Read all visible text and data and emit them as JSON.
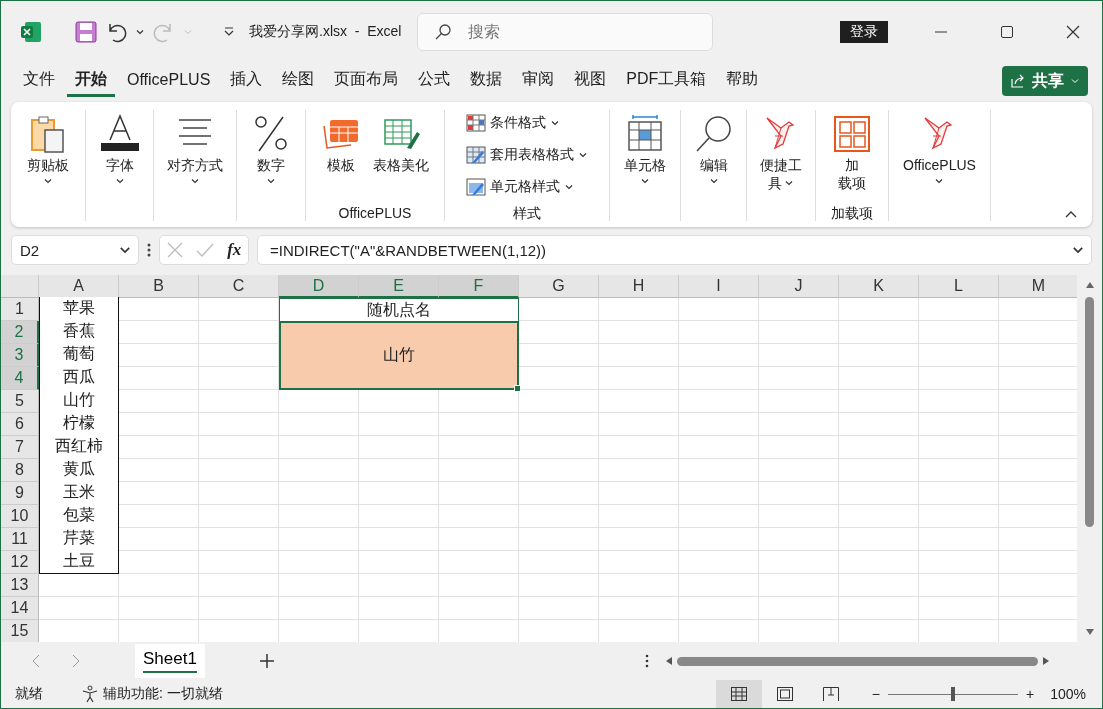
{
  "title_bar": {
    "title": "我爱分享网.xlsx  -  Excel",
    "search_placeholder": "搜索",
    "login": "登录",
    "redo_disabled": true
  },
  "menu_tabs": [
    {
      "label": "文件",
      "selected": false
    },
    {
      "label": "开始",
      "selected": true
    },
    {
      "label": "OfficePLUS",
      "selected": false
    },
    {
      "label": "插入",
      "selected": false
    },
    {
      "label": "绘图",
      "selected": false
    },
    {
      "label": "页面布局",
      "selected": false
    },
    {
      "label": "公式",
      "selected": false
    },
    {
      "label": "数据",
      "selected": false
    },
    {
      "label": "审阅",
      "selected": false
    },
    {
      "label": "视图",
      "selected": false
    },
    {
      "label": "PDF工具箱",
      "selected": false
    },
    {
      "label": "帮助",
      "selected": false
    }
  ],
  "share_button": "共享",
  "ribbon": {
    "groups": [
      {
        "buttons": [
          {
            "kind": "large",
            "lines": [
              "剪贴板"
            ],
            "dropdown": true
          }
        ]
      },
      {
        "buttons": [
          {
            "kind": "large",
            "lines": [
              "字体"
            ],
            "dropdown": true
          }
        ]
      },
      {
        "buttons": [
          {
            "kind": "large",
            "lines": [
              "对齐方式"
            ],
            "dropdown": true
          }
        ]
      },
      {
        "buttons": [
          {
            "kind": "large",
            "lines": [
              "数字"
            ],
            "dropdown": true
          }
        ]
      },
      {
        "label": "OfficePLUS",
        "buttons": [
          {
            "kind": "large",
            "lines": [
              "模板"
            ],
            "dropdown": false
          },
          {
            "kind": "large",
            "lines": [
              "表格美化"
            ],
            "dropdown": false
          }
        ]
      },
      {
        "label": "样式",
        "buttons": [
          {
            "kind": "small",
            "lines": [
              "条件格式"
            ],
            "dropdown": true
          },
          {
            "kind": "small",
            "lines": [
              "套用表格格式"
            ],
            "dropdown": true
          },
          {
            "kind": "small",
            "lines": [
              "单元格样式"
            ],
            "dropdown": true
          }
        ]
      },
      {
        "buttons": [
          {
            "kind": "large",
            "lines": [
              "单元格"
            ],
            "dropdown": true
          }
        ]
      },
      {
        "buttons": [
          {
            "kind": "large",
            "lines": [
              "编辑"
            ],
            "dropdown": true
          }
        ]
      },
      {
        "buttons": [
          {
            "kind": "large",
            "lines": [
              "便捷工",
              "具"
            ],
            "dropdown": true
          }
        ]
      },
      {
        "label": "加载项",
        "buttons": [
          {
            "kind": "large",
            "lines": [
              "加",
              "载项"
            ],
            "dropdown": false
          }
        ]
      },
      {
        "buttons": [
          {
            "kind": "large",
            "lines": [
              "OfficePLUS"
            ],
            "dropdown": true
          }
        ]
      }
    ]
  },
  "formula_bar": {
    "name_box": "D2",
    "function_label": "fx",
    "formula": "=INDIRECT(\"A\"&RANDBETWEEN(1,12))"
  },
  "sheet": {
    "columns": [
      {
        "label": "A",
        "selected": false
      },
      {
        "label": "B",
        "selected": false
      },
      {
        "label": "C",
        "selected": false
      },
      {
        "label": "D",
        "selected": true
      },
      {
        "label": "E",
        "selected": true
      },
      {
        "label": "F",
        "selected": true
      },
      {
        "label": "G",
        "selected": false
      },
      {
        "label": "H",
        "selected": false
      },
      {
        "label": "I",
        "selected": false
      },
      {
        "label": "J",
        "selected": false
      },
      {
        "label": "K",
        "selected": false
      },
      {
        "label": "L",
        "selected": false
      },
      {
        "label": "M",
        "selected": false
      }
    ],
    "rows": [
      {
        "label": "1",
        "selected": false,
        "column_a": "苹果"
      },
      {
        "label": "2",
        "selected": true,
        "column_a": "香蕉"
      },
      {
        "label": "3",
        "selected": true,
        "column_a": "葡萄"
      },
      {
        "label": "4",
        "selected": true,
        "column_a": "西瓜"
      },
      {
        "label": "5",
        "selected": false,
        "column_a": "山竹"
      },
      {
        "label": "6",
        "selected": false,
        "column_a": "柠檬"
      },
      {
        "label": "7",
        "selected": false,
        "column_a": "西红柿"
      },
      {
        "label": "8",
        "selected": false,
        "column_a": "黄瓜"
      },
      {
        "label": "9",
        "selected": false,
        "column_a": "玉米"
      },
      {
        "label": "10",
        "selected": false,
        "column_a": "包菜"
      },
      {
        "label": "11",
        "selected": false,
        "column_a": "芹菜"
      },
      {
        "label": "12",
        "selected": false,
        "column_a": "土豆"
      },
      {
        "label": "13",
        "selected": false
      },
      {
        "label": "14",
        "selected": false
      },
      {
        "label": "15",
        "selected": false
      }
    ],
    "title_cell": "随机点名",
    "result_cell": "山竹"
  },
  "sheet_tabs": [
    {
      "label": "Sheet1",
      "selected": true
    }
  ],
  "status_bar": {
    "ready": "就绪",
    "accessibility": "辅助功能: 一切就绪",
    "views": [
      {
        "selected": true
      },
      {
        "selected": false
      },
      {
        "selected": false
      }
    ],
    "zoom": {
      "zoom_out": "−",
      "zoom_in": "+",
      "level": 0.5,
      "reading": "100%"
    }
  }
}
